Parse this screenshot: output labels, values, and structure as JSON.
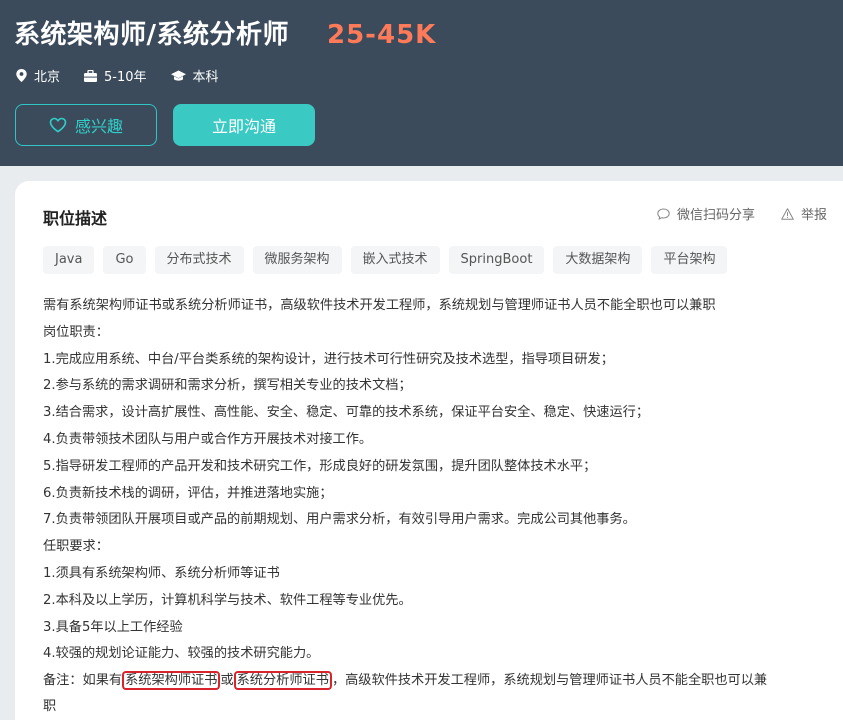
{
  "job": {
    "title": "系统架构师/系统分析师",
    "salary": "25-45K",
    "location": "北京",
    "experience": "5-10年",
    "education": "本科"
  },
  "buttons": {
    "interest": "感兴趣",
    "chat": "立即沟通"
  },
  "section": {
    "title": "职位描述",
    "share": "微信扫码分享",
    "report": "举报"
  },
  "tags": [
    "Java",
    "Go",
    "分布式技术",
    "微服务架构",
    "嵌入式技术",
    "SpringBoot",
    "大数据架构",
    "平台架构"
  ],
  "description": [
    "需有系统架构师证书或系统分析师证书，高级软件技术开发工程师，系统规划与管理师证书人员不能全职也可以兼职",
    "岗位职责：",
    "1.完成应用系统、中台/平台类系统的架构设计，进行技术可行性研究及技术选型，指导项目研发；",
    "2.参与系统的需求调研和需求分析，撰写相关专业的技术文档；",
    "3.结合需求，设计高扩展性、高性能、安全、稳定、可靠的技术系统，保证平台安全、稳定、快速运行；",
    "4.负责带领技术团队与用户或合作方开展技术对接工作。",
    "5.指导研发工程师的产品开发和技术研究工作，形成良好的研发氛围，提升团队整体技术水平；",
    "6.负责新技术栈的调研，评估，并推进落地实施；",
    "7.负责带领团队开展项目或产品的前期规划、用户需求分析，有效引导用户需求。完成公司其他事务。",
    "任职要求：",
    "1.须具有系统架构师、系统分析师等证书",
    "2.本科及以上学历，计算机科学与技术、软件工程等专业优先。",
    "3.具备5年以上工作经验",
    "4.较强的规划论证能力、较强的技术研究能力。"
  ],
  "note": {
    "prefix": "备注：如果有",
    "cert1": "系统架构师证书",
    "or": "或",
    "cert2": "系统分析师证书",
    "rest": "，高级软件技术开发工程师，系统规划与管理师证书人员不能全职也可以兼",
    "tail": "职"
  },
  "colors": {
    "header_bg": "#3b4b5c",
    "salary": "#ff7a59",
    "accent": "#3bc9c3",
    "highlight_border": "#d9232d"
  }
}
